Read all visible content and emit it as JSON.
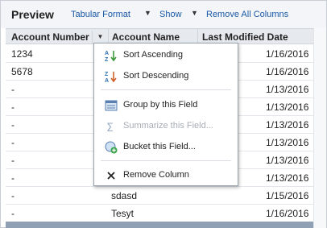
{
  "header": {
    "title": "Preview",
    "format_label": "Tabular Format",
    "show_label": "Show",
    "remove_all_label": "Remove All Columns"
  },
  "columns": [
    "Account Number",
    "Account Name",
    "Last Modified Date"
  ],
  "rows": [
    {
      "account_number": "1234",
      "account_name": "",
      "last_modified": "1/16/2016"
    },
    {
      "account_number": "5678",
      "account_name": "",
      "last_modified": "1/16/2016"
    },
    {
      "account_number": "-",
      "account_name": "",
      "last_modified": "1/13/2016"
    },
    {
      "account_number": "-",
      "account_name": "",
      "last_modified": "1/13/2016"
    },
    {
      "account_number": "-",
      "account_name": "",
      "last_modified": "1/13/2016"
    },
    {
      "account_number": "-",
      "account_name": "",
      "last_modified": "1/13/2016"
    },
    {
      "account_number": "-",
      "account_name": "",
      "last_modified": "1/13/2016"
    },
    {
      "account_number": "-",
      "account_name": "",
      "last_modified": "1/13/2016"
    },
    {
      "account_number": "-",
      "account_name": "sdasd",
      "last_modified": "1/15/2016"
    },
    {
      "account_number": "-",
      "account_name": "Tesyt",
      "last_modified": "1/16/2016"
    }
  ],
  "column_menu": {
    "items": [
      {
        "label": "Sort Ascending",
        "icon": "sort-ascending-icon",
        "enabled": true
      },
      {
        "label": "Sort Descending",
        "icon": "sort-descending-icon",
        "enabled": true
      },
      {
        "label": "Group by this Field",
        "icon": "group-icon",
        "enabled": true
      },
      {
        "label": "Summarize this Field...",
        "icon": "summarize-icon",
        "enabled": false
      },
      {
        "label": "Bucket this Field...",
        "icon": "bucket-icon",
        "enabled": true
      },
      {
        "label": "Remove Column",
        "icon": "remove-icon",
        "enabled": true
      }
    ]
  },
  "colors": {
    "link": "#1a5aa6",
    "header_bg": "#e6eaef",
    "footer_bar": "#8fa0b4"
  }
}
